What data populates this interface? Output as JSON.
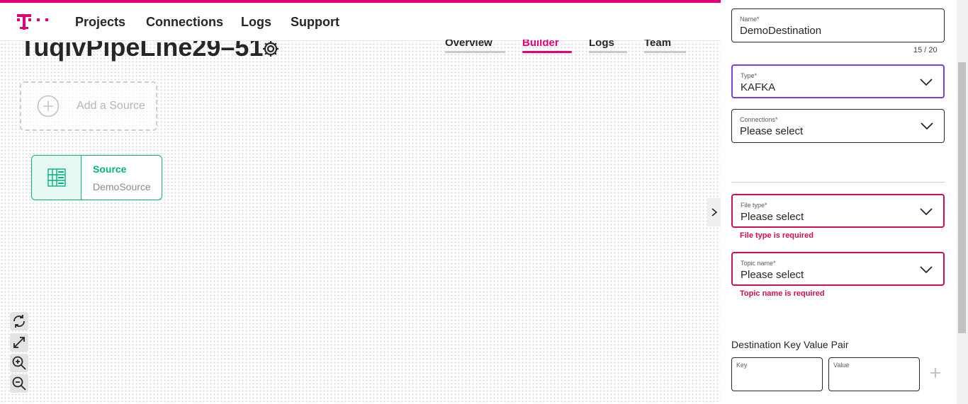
{
  "brand": {
    "accent": "#e20074",
    "success": "#00b383",
    "error": "#d0104c",
    "focus": "#7c3aed"
  },
  "nav": {
    "items": [
      "Projects",
      "Connections",
      "Logs",
      "Support"
    ]
  },
  "page": {
    "title": "TuqivPipeLine29–51"
  },
  "tabs": [
    {
      "label": "Overview",
      "active": false
    },
    {
      "label": "Builder",
      "active": true
    },
    {
      "label": "Logs",
      "active": false
    },
    {
      "label": "Team",
      "active": false
    }
  ],
  "canvas": {
    "add_source_label": "Add a Source",
    "source_node": {
      "type_label": "Source",
      "name": "DemoSource",
      "icon": "server-rack-icon"
    }
  },
  "zoom_controls": [
    "refresh-icon",
    "fit-view-icon",
    "zoom-in-icon",
    "zoom-out-icon"
  ],
  "form": {
    "name": {
      "label": "Name*",
      "value": "DemoDestination",
      "counter": "15 / 20"
    },
    "type": {
      "label": "Type*",
      "value": "KAFKA"
    },
    "connections": {
      "label": "Connections*",
      "value": "Please select"
    },
    "file_type": {
      "label": "File type*",
      "value": "Please select",
      "error": "File type is required"
    },
    "topic_name": {
      "label": "Topic name*",
      "value": "Please select",
      "error": "Topic name is required"
    },
    "kv_section": {
      "title": "Destination Key Value Pair",
      "key_label": "Key",
      "value_label": "Value"
    }
  }
}
